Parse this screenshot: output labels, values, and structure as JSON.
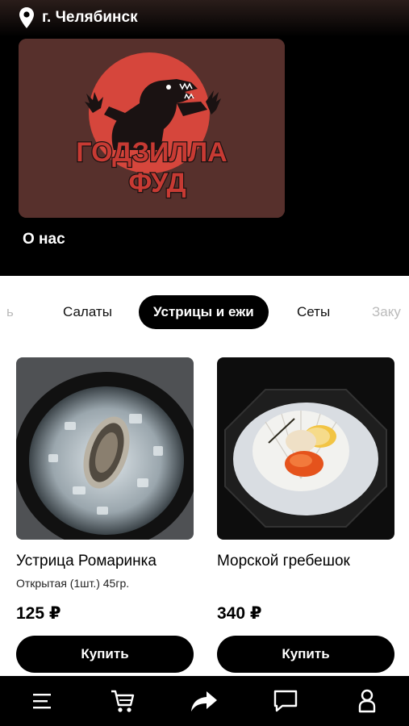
{
  "header": {
    "city": "г. Челябинск",
    "icon": "location-pin-icon"
  },
  "brand": {
    "logo_line1": "ГОДЗИЛЛА",
    "logo_line2": "ФУД",
    "colors": {
      "background": "#57302c",
      "circle": "#d6463c",
      "text": "#c73a33"
    }
  },
  "about_label": "О нас",
  "categories": [
    {
      "label": "ь",
      "state": "faded"
    },
    {
      "label": "Салаты",
      "state": "normal"
    },
    {
      "label": "Устрицы и ежи",
      "state": "active"
    },
    {
      "label": "Сеты",
      "state": "normal"
    },
    {
      "label": "Заку",
      "state": "faded"
    }
  ],
  "products": [
    {
      "title": "Устрица Ромаринка",
      "description": "Открытая (1шт.) 45гр.",
      "price": "125 ₽",
      "buy_label": "Купить"
    },
    {
      "title": "Морской гребешок",
      "description": "",
      "price": "340 ₽",
      "buy_label": "Купить"
    }
  ],
  "bottom_nav": [
    {
      "icon": "menu-icon"
    },
    {
      "icon": "cart-icon"
    },
    {
      "icon": "share-arrow-icon"
    },
    {
      "icon": "chat-icon"
    },
    {
      "icon": "profile-icon"
    }
  ]
}
